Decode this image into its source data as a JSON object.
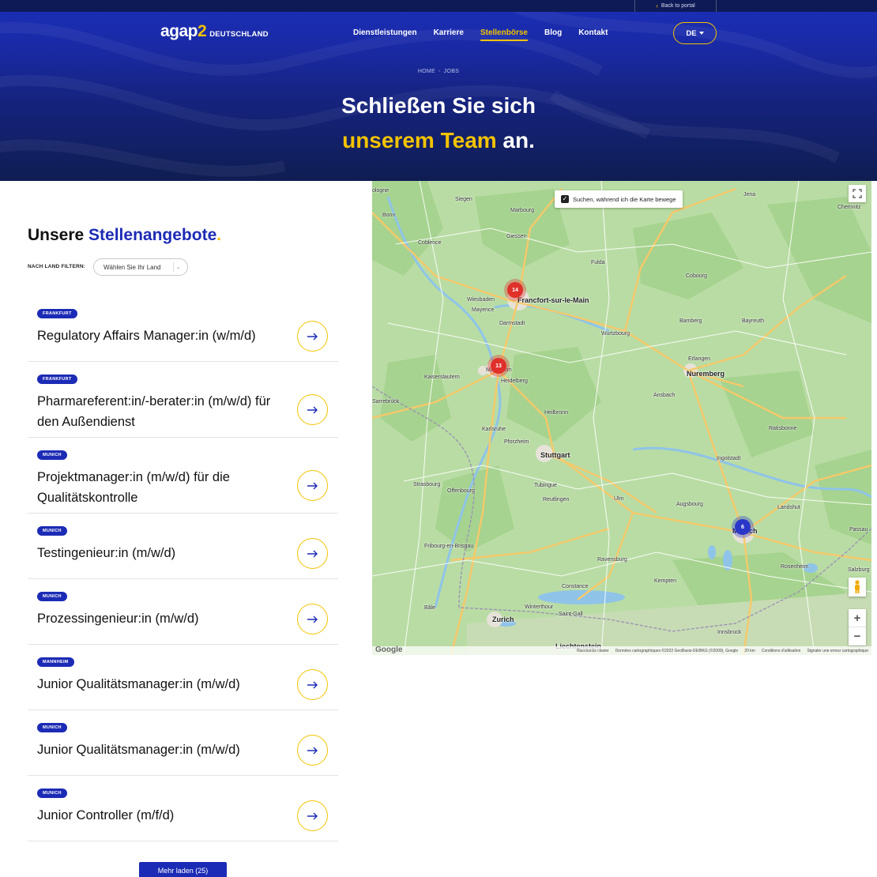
{
  "topbar": {
    "back_label": "Back to portal"
  },
  "header": {
    "logo_main": "agap",
    "logo_two": "2",
    "logo_sub": "DEUTSCHLAND",
    "nav": [
      {
        "label": "Dienstleistungen",
        "active": false
      },
      {
        "label": "Karriere",
        "active": false
      },
      {
        "label": "Stellenbörse",
        "active": true
      },
      {
        "label": "Blog",
        "active": false
      },
      {
        "label": "Kontakt",
        "active": false
      }
    ],
    "language": "DE"
  },
  "hero": {
    "breadcrumb": [
      "HOME",
      "JOBS"
    ],
    "title_line1": "Schließen Sie sich",
    "title_line2_highlight": "unserem Team",
    "title_line2_rest": " an."
  },
  "offers": {
    "heading_prefix": "Unsere ",
    "heading_highlight": "Stellenangebote",
    "heading_dot": ".",
    "filter_label": "NACH LAND FILTERN:",
    "filter_placeholder": "Wählen Sie Ihr Land",
    "jobs": [
      {
        "city": "FRANKFURT",
        "title": "Regulatory Affairs Manager:in (w/m/d)"
      },
      {
        "city": "FRANKFURT",
        "title": "Pharmareferent:in/-berater:in (m/w/d) für den Außendienst"
      },
      {
        "city": "MUNICH",
        "title": "Projektmanager:in (m/w/d) für die Qualitätskontrolle"
      },
      {
        "city": "MUNICH",
        "title": "Testingenieur:in (m/w/d)"
      },
      {
        "city": "MUNICH",
        "title": "Prozessingenieur:in (m/w/d)"
      },
      {
        "city": "MANNHEIM",
        "title": "Junior Qualitätsmanager:in (m/w/d)"
      },
      {
        "city": "MUNICH",
        "title": "Junior Qualitätsmanager:in (m/w/d)"
      },
      {
        "city": "MUNICH",
        "title": "Junior Controller (m/f/d)"
      }
    ],
    "more_button": "Mehr laden (25)"
  },
  "map": {
    "search_toggle_label": "Suchen, während ich die Karte bewege",
    "search_toggle_checked": true,
    "clusters": [
      {
        "count": "14",
        "color": "#e0302a"
      },
      {
        "count": "13",
        "color": "#e0302a"
      },
      {
        "count": "6",
        "color": "#2a37c9"
      }
    ],
    "labels": {
      "frankfurt": "Francfort-sur-le-Main",
      "mannheim": "Mannheim",
      "heidelberg": "Heidelberg",
      "nuremberg": "Nuremberg",
      "stuttgart": "Stuttgart",
      "munich": "Munich",
      "zurich": "Zurich",
      "liechtenstein": "Liechtenstein",
      "bonn": "Bonn",
      "koblenz": "Coblence",
      "wiesbaden": "Wiesbaden",
      "mayence": "Mayence",
      "darmstadt": "Darmstadt",
      "wurzburg": "Wurtzbourg",
      "bamberg": "Bamberg",
      "erlangen": "Erlangen",
      "karlsruhe": "Karlsruhe",
      "pforzheim": "Pforzheim",
      "heilbronn": "Heilbronn",
      "augsburg": "Augsbourg",
      "ingolstadt": "Ingolstadt",
      "regensburg": "Ratisbonne",
      "ulm": "Ulm",
      "strasbourg": "Strasbourg",
      "freiburg": "Fribourg-en-Brisgau",
      "basel": "Bâle",
      "konstanz": "Constance",
      "innsbruck": "Innsbruck",
      "salzburg": "Salzburg",
      "chemnitz": "Chemnitz",
      "kaiserslautern": "Kaiserslautern",
      "saarbrucken": "Sarrebruck",
      "giessen": "Giessen",
      "marburg": "Marbourg",
      "fulda": "Fulda",
      "jena": "Jena",
      "coburg": "Cobourg",
      "bayreuth": "Bayreuth",
      "ansbach": "Ansbach",
      "landshut": "Landshut",
      "rosenheim": "Rosenheim",
      "kempten": "Kempten",
      "ravensburg": "Ravensburg",
      "tubingen": "Tubingue",
      "reutlingen": "Reutlingen",
      "offenburg": "Offenbourg",
      "winterthur": "Winterthour",
      "saint_gall": "Saint-Gall",
      "cologne": "ologne",
      "siegen": "Siegen",
      "passau": "Passau"
    },
    "footer": [
      "Raccourcis clavier",
      "Données cartographiques ©2022 GeoBasis-DE/BKG (©2009), Google",
      "20 km",
      "Conditions d'utilisation",
      "Signaler une erreur cartographique"
    ],
    "google": "Google",
    "colors": {
      "land": "#b9dca4",
      "forest": "#a6d38f",
      "water": "#8fc4e8",
      "motorway": "#f6c96a",
      "road": "#ffffff"
    }
  },
  "colors": {
    "brand_blue": "#1c2bb5",
    "accent_yellow": "#f3c300",
    "hero_dark": "#0f1d52"
  }
}
